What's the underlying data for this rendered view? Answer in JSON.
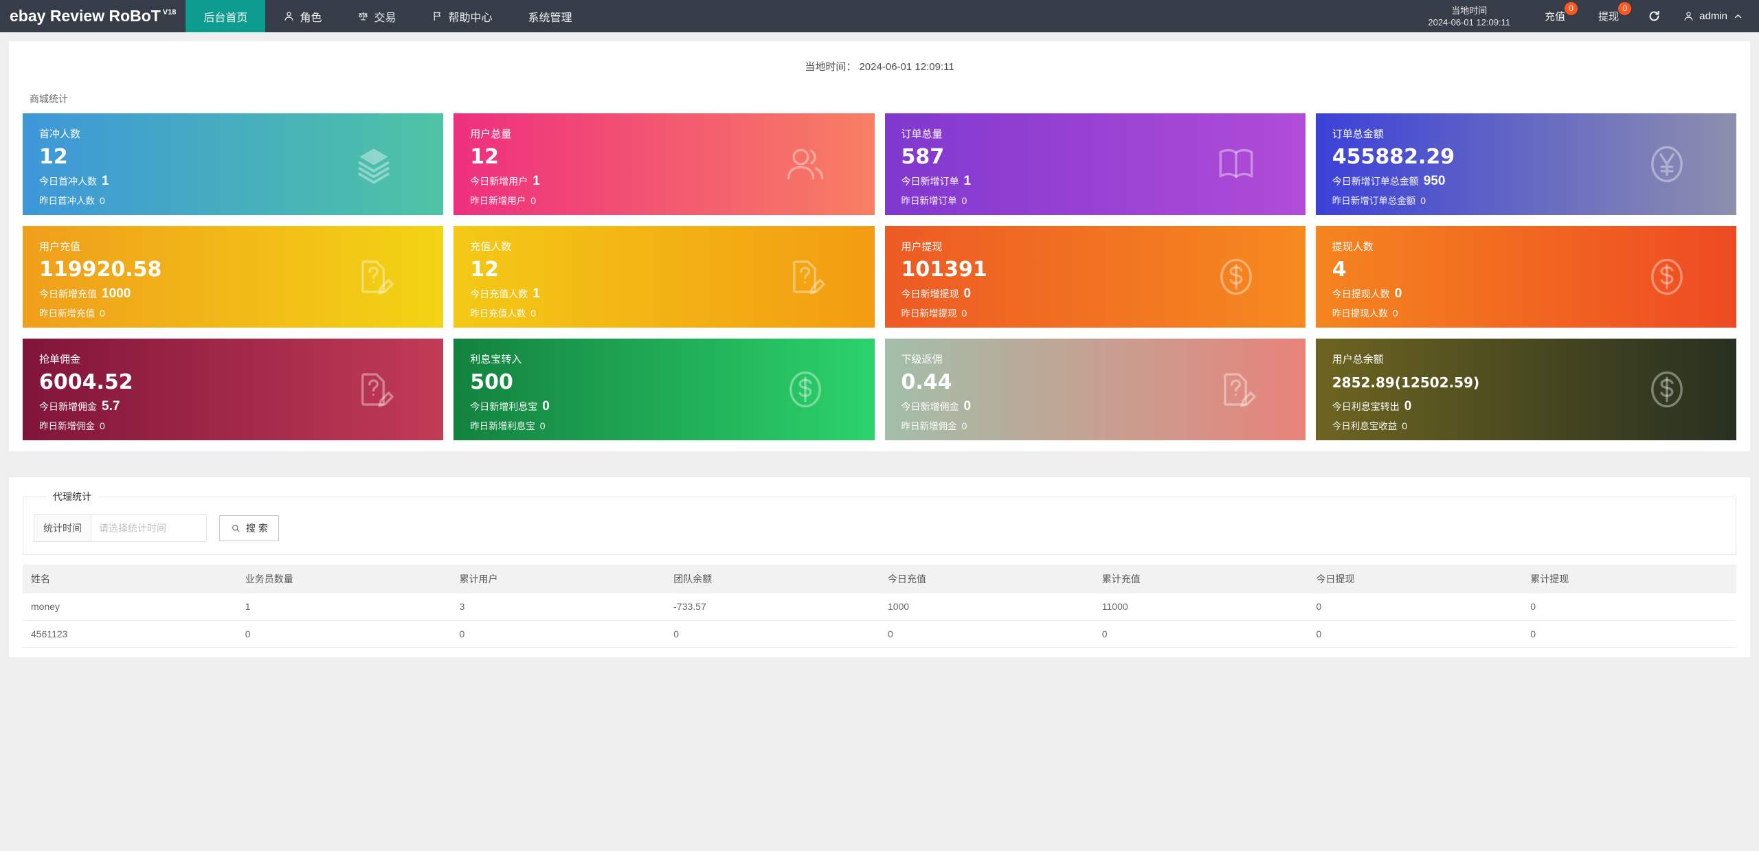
{
  "navbar": {
    "logo": "ebay Review RoBoT",
    "logo_version": "V18",
    "menu": [
      {
        "label": "后台首页",
        "active": true
      },
      {
        "label": "角色",
        "icon": "user-icon"
      },
      {
        "label": "交易",
        "icon": "scales-icon"
      },
      {
        "label": "帮助中心",
        "icon": "flag-icon"
      },
      {
        "label": "系统管理"
      }
    ],
    "local_time_label": "当地时间",
    "local_time_value": "2024-06-01 12:09:11",
    "recharge": {
      "label": "充值",
      "badge": "0"
    },
    "withdraw": {
      "label": "提现",
      "badge": "0"
    },
    "username": "admin",
    "accent_color": "#0d9c8f",
    "badge_color": "#ff5722"
  },
  "content": {
    "time_label": "当地时间：",
    "time_value": "2024-06-01 12:09:11",
    "section_title": "商城统计",
    "cards": [
      {
        "title": "首冲人数",
        "value": "12",
        "line2_label": "今日首冲人数",
        "line2_value": "1",
        "line3_label": "昨日首冲人数",
        "line3_value": "0",
        "icon": "layers-icon",
        "gradient": [
          "#3e97d9",
          "#4ec4a4"
        ]
      },
      {
        "title": "用户总量",
        "value": "12",
        "line2_label": "今日新增用户",
        "line2_value": "1",
        "line3_label": "昨日新增用户",
        "line3_value": "0",
        "icon": "users-icon",
        "gradient": [
          "#ee2f7f",
          "#f87f63"
        ]
      },
      {
        "title": "订单总量",
        "value": "587",
        "line2_label": "今日新增订单",
        "line2_value": "1",
        "line3_label": "昨日新增订单",
        "line3_value": "0",
        "icon": "book-icon",
        "gradient": [
          "#8038ce",
          "#b14cd8"
        ]
      },
      {
        "title": "订单总金额",
        "value": "455882.29",
        "line2_label": "今日新增订单总金额",
        "line2_value": "950",
        "line3_label": "昨日新增订单总金额",
        "line3_value": "0",
        "icon": "yen-circle-icon",
        "gradient": [
          "#3c41d8",
          "#8d8fae"
        ]
      },
      {
        "title": "用户充值",
        "value": "119920.58",
        "line2_label": "今日新增充值",
        "line2_value": "1000",
        "line3_label": "昨日新增充值",
        "line3_value": "0",
        "icon": "file-edit-icon",
        "gradient": [
          "#f09e1b",
          "#f3d414"
        ]
      },
      {
        "title": "充值人数",
        "value": "12",
        "line2_label": "今日充值人数",
        "line2_value": "1",
        "line3_label": "昨日充值人数",
        "line3_value": "0",
        "icon": "file-edit-icon",
        "gradient": [
          "#f3c916",
          "#f39c12"
        ]
      },
      {
        "title": "用户提现",
        "value": "101391",
        "line2_label": "今日新增提现",
        "line2_value": "0",
        "line3_label": "昨日新增提现",
        "line3_value": "0",
        "icon": "dollar-circle-icon",
        "gradient": [
          "#ed5a24",
          "#f68a1f"
        ]
      },
      {
        "title": "提现人数",
        "value": "4",
        "line2_label": "今日提现人数",
        "line2_value": "0",
        "line3_label": "昨日提现人数",
        "line3_value": "0",
        "icon": "dollar-circle-icon",
        "gradient": [
          "#f5851f",
          "#ee4a22"
        ]
      },
      {
        "title": "抢单佣金",
        "value": "6004.52",
        "line2_label": "今日新增佣金",
        "line2_value": "5.7",
        "line3_label": "昨日新增佣金",
        "line3_value": "0",
        "icon": "file-edit-icon",
        "gradient": [
          "#801539",
          "#c23b57"
        ]
      },
      {
        "title": "利息宝转入",
        "value": "500",
        "line2_label": "今日新增利息宝",
        "line2_value": "0",
        "line3_label": "昨日新增利息宝",
        "line3_value": "0",
        "icon": "dollar-circle-icon",
        "gradient": [
          "#13823f",
          "#2cd36c"
        ]
      },
      {
        "title": "下级返佣",
        "value": "0.44",
        "line2_label": "今日新增佣金",
        "line2_value": "0",
        "line3_label": "昨日新增佣金",
        "line3_value": "0",
        "icon": "file-edit-icon",
        "gradient": [
          "#a2bfaa",
          "#e8837a"
        ]
      },
      {
        "title": "用户总余额",
        "value": "2852.89(12502.59)",
        "line2_label": "今日利息宝转出",
        "line2_value": "0",
        "line3_label": "今日利息宝收益",
        "line3_value": "0",
        "icon": "dollar-circle-icon",
        "gradient": [
          "#6d6420",
          "#273020"
        ]
      }
    ]
  },
  "agent": {
    "legend": "代理统计",
    "filter_label": "统计时间",
    "filter_placeholder": "请选择统计时间",
    "search_label": "搜 索",
    "table": {
      "headers": [
        "姓名",
        "业务员数量",
        "累计用户",
        "团队余额",
        "今日充值",
        "累计充值",
        "今日提现",
        "累计提现"
      ],
      "rows": [
        [
          "money",
          "1",
          "3",
          "-733.57",
          "1000",
          "11000",
          "0",
          "0"
        ],
        [
          "4561123",
          "0",
          "0",
          "0",
          "0",
          "0",
          "0",
          "0"
        ]
      ]
    }
  }
}
